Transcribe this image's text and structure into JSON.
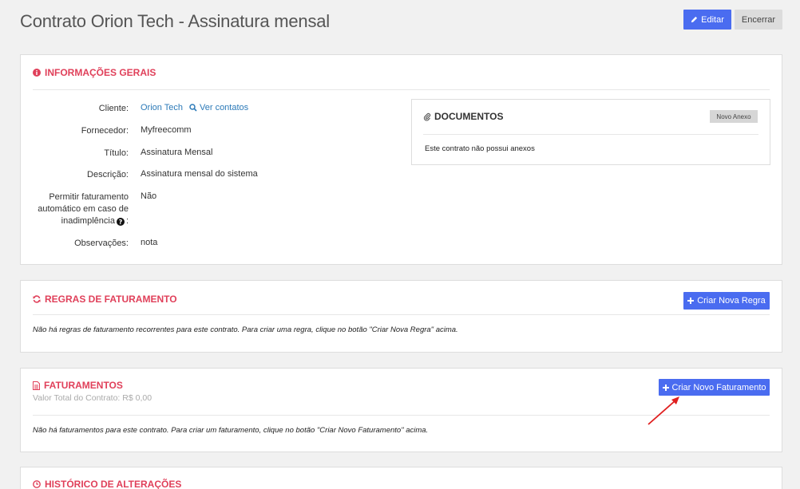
{
  "header": {
    "title": "Contrato Orion Tech - Assinatura mensal",
    "edit_label": "Editar",
    "close_label": "Encerrar"
  },
  "info": {
    "heading": "INFORMAÇÕES GERAIS",
    "rows": [
      {
        "label": "Cliente:",
        "value": "Orion Tech",
        "extra": "Ver contatos"
      },
      {
        "label": "Fornecedor:",
        "value": "Myfreecomm"
      },
      {
        "label": "Título:",
        "value": "Assinatura Mensal"
      },
      {
        "label": "Descrição:",
        "value": "Assinatura mensal do sistema"
      },
      {
        "label_lines": [
          "Permitir faturamento",
          "automático em caso de",
          "inadimplência"
        ],
        "label_suffix": ":",
        "value": "Não"
      },
      {
        "label": "Observações:",
        "value": "nota"
      }
    ]
  },
  "documents": {
    "heading": "DOCUMENTOS",
    "new_attachment_label": "Novo Anexo",
    "empty_text": "Este contrato não possui anexos"
  },
  "billing_rules": {
    "heading": "REGRAS DE FATURAMENTO",
    "create_label": "Criar Nova Regra",
    "empty_text": "Não há regras de faturamento recorrentes para este contrato. Para criar uma regra, clique no botão \"Criar Nova Regra\" acima."
  },
  "invoices": {
    "heading": "FATURAMENTOS",
    "total_text": "Valor Total do Contrato: R$ 0,00",
    "create_label": "Criar Novo Faturamento",
    "empty_text": "Não há faturamentos para este contrato. Para criar um faturamento, clique no botão \"Criar Novo Faturamento\" acima."
  },
  "history": {
    "heading": "HISTÓRICO DE ALTERAÇÕES"
  },
  "colors": {
    "accent": "#e0405a",
    "primary": "#4a6cf0",
    "link": "#2c7ab8",
    "annotation_arrow": "#e01f1f"
  }
}
